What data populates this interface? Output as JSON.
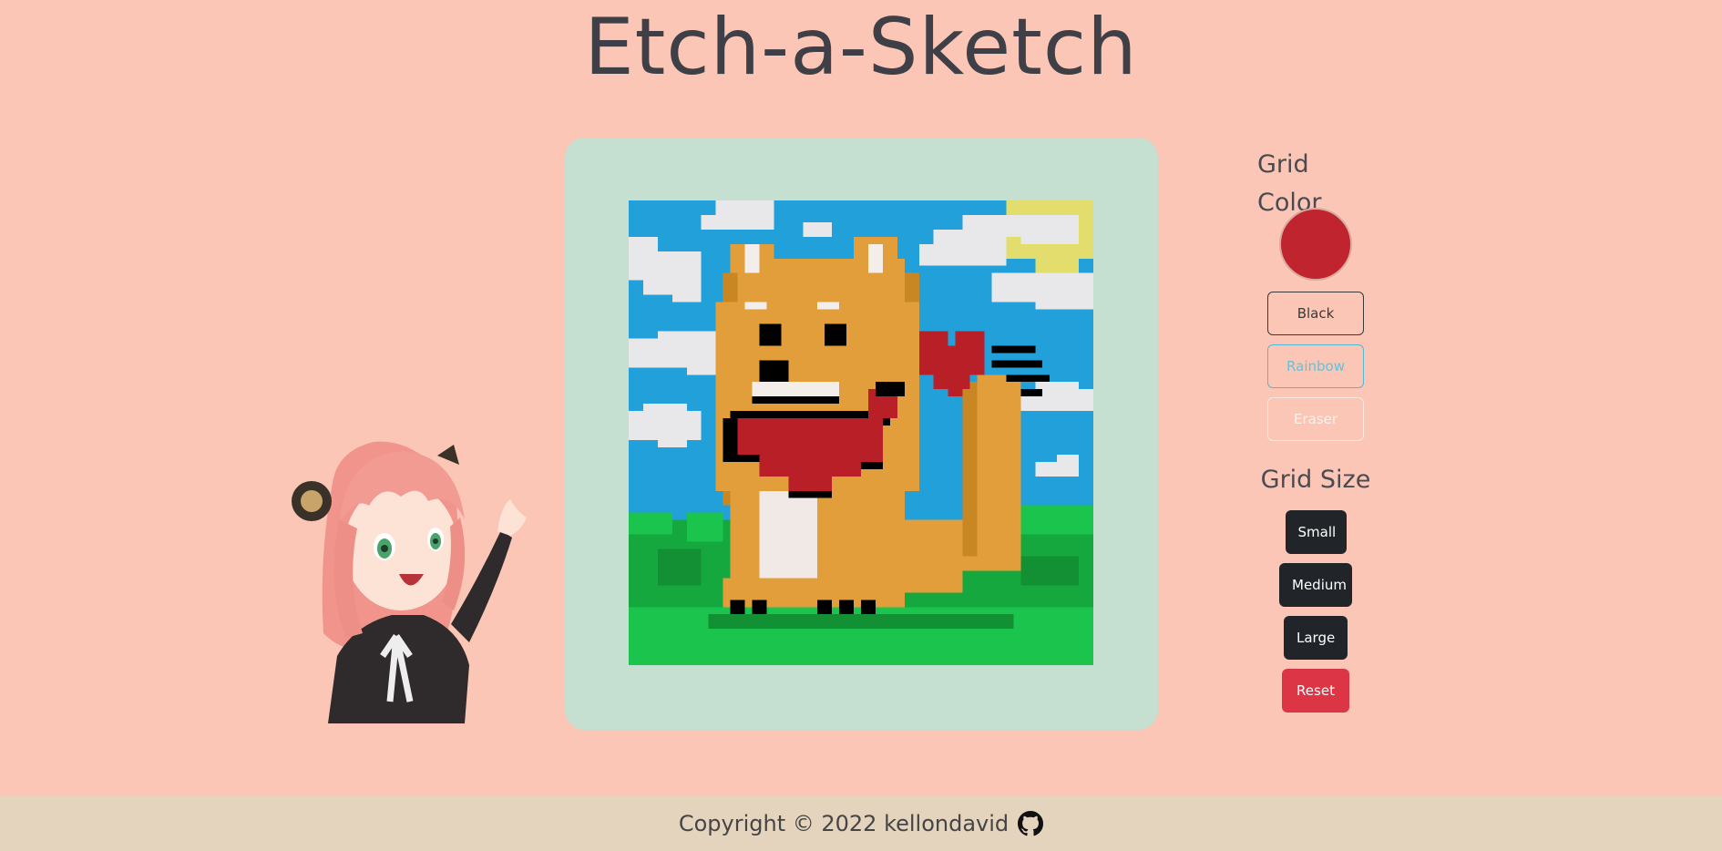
{
  "title": "Etch-a-Sketch",
  "controls": {
    "grid_color_heading": "Grid Color",
    "selected_color": "#c0242e",
    "black_label": "Black",
    "rainbow_label": "Rainbow",
    "eraser_label": "Eraser",
    "grid_size_heading": "Grid Size",
    "small_label": "Small",
    "medium_label": "Medium",
    "large_label": "Large",
    "reset_label": "Reset"
  },
  "footer": {
    "text": "Copyright © 2022 kellondavid",
    "icon": "github-icon"
  },
  "colors": {
    "background": "#fbc6b5",
    "board": "#c5dfd1",
    "footer": "#e4d3bd",
    "sky": "#22a0d9",
    "grass": "#1bc44d",
    "dog": "#e39e3c",
    "bandana": "#b91f27"
  },
  "canvas": {
    "grid_cells": 64
  }
}
